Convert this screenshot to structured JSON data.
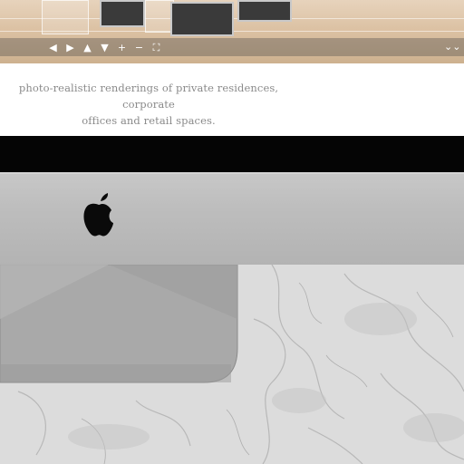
{
  "viewer": {
    "toolbar": {
      "buttons": [
        {
          "name": "pan-left-button",
          "glyph": "◀"
        },
        {
          "name": "pan-right-button",
          "glyph": "▶"
        },
        {
          "name": "pan-up-button",
          "glyph": "▲"
        },
        {
          "name": "pan-down-button",
          "glyph": "▼"
        },
        {
          "name": "zoom-in-button",
          "glyph": "+"
        },
        {
          "name": "zoom-out-button",
          "glyph": "−"
        },
        {
          "name": "fullscreen-button",
          "glyph": "⛶"
        }
      ],
      "expand_glyph": "⌄⌄"
    }
  },
  "description": {
    "line1": "photo-realistic renderings of private residences, corporate",
    "line2": "offices and retail spaces."
  },
  "colors": {
    "bezel": "#050505",
    "aluminum": "#bdbdbd",
    "text": "#8a8a8a"
  }
}
